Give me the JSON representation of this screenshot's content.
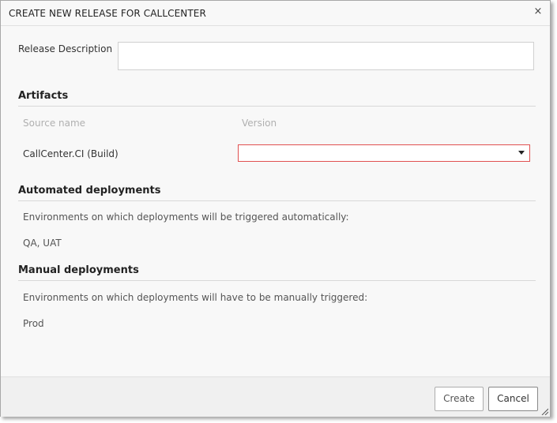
{
  "dialog": {
    "title": "CREATE NEW RELEASE FOR CALLCENTER",
    "close_glyph": "×"
  },
  "release": {
    "description_label": "Release Description",
    "description_value": ""
  },
  "artifacts": {
    "heading": "Artifacts",
    "col_source": "Source name",
    "col_version": "Version",
    "rows": [
      {
        "source": "CallCenter.CI (Build)",
        "version": ""
      }
    ]
  },
  "automated": {
    "heading": "Automated deployments",
    "description": "Environments on which deployments will be triggered automatically:",
    "environments": "QA, UAT"
  },
  "manual": {
    "heading": "Manual deployments",
    "description": "Environments on which deployments will have to be manually triggered:",
    "environments": "Prod"
  },
  "footer": {
    "create_label": "Create",
    "cancel_label": "Cancel"
  },
  "icons": {
    "close": "close-icon",
    "dropdown": "chevron-down-icon",
    "resize": "resize-grip-icon"
  },
  "colors": {
    "error_border": "#e05050"
  }
}
